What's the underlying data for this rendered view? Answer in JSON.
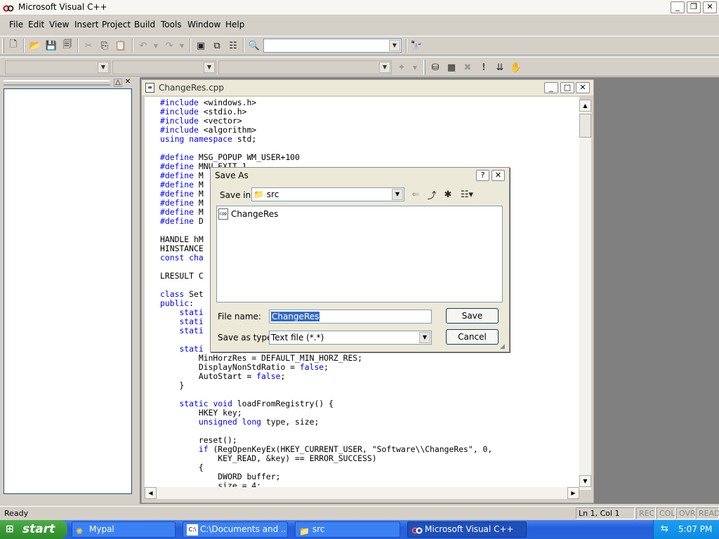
{
  "app": {
    "title": "Microsoft Visual C++"
  },
  "menu": [
    "File",
    "Edit",
    "View",
    "Insert",
    "Project",
    "Build",
    "Tools",
    "Window",
    "Help"
  ],
  "document": {
    "title": "ChangeRes.cpp",
    "code_lines": [
      [
        [
          "kw",
          "#include"
        ],
        [
          "",
          "<windows.h>"
        ]
      ],
      [
        [
          "kw",
          "#include"
        ],
        [
          "",
          "<stdio.h>"
        ]
      ],
      [
        [
          "kw",
          "#include"
        ],
        [
          "",
          "<vector>"
        ]
      ],
      [
        [
          "kw",
          "#include"
        ],
        [
          "",
          "<algorithm>"
        ]
      ],
      [
        [
          "kw",
          "using"
        ],
        [
          "",
          ""
        ],
        [
          "kw",
          "namespace"
        ],
        [
          "",
          "std;"
        ]
      ],
      [
        [
          "",
          ""
        ]
      ],
      [
        [
          "kw",
          "#define"
        ],
        [
          "",
          "MSG_POPUP WM_USER+100"
        ]
      ],
      [
        [
          "kw",
          "#define"
        ],
        [
          "",
          "MNU_EXIT 1"
        ]
      ],
      [
        [
          "kw",
          "#define"
        ],
        [
          "",
          "M"
        ]
      ],
      [
        [
          "kw",
          "#define"
        ],
        [
          "",
          "M"
        ]
      ],
      [
        [
          "kw",
          "#define"
        ],
        [
          "",
          "M"
        ]
      ],
      [
        [
          "kw",
          "#define"
        ],
        [
          "",
          "M"
        ]
      ],
      [
        [
          "kw",
          "#define"
        ],
        [
          "",
          "M"
        ]
      ],
      [
        [
          "kw",
          "#define"
        ],
        [
          "",
          "D"
        ]
      ],
      [
        [
          "",
          ""
        ]
      ],
      [
        [
          "",
          "HANDLE hM"
        ]
      ],
      [
        [
          "",
          "HINSTANCE"
        ]
      ],
      [
        [
          "kw",
          "const"
        ],
        [
          "",
          ""
        ],
        [
          "kw",
          "cha"
        ]
      ],
      [
        [
          "",
          ""
        ]
      ],
      [
        [
          "",
          "LRESULT C"
        ]
      ],
      [
        [
          "",
          ""
        ]
      ],
      [
        [
          "kw",
          "class"
        ],
        [
          "",
          "Set"
        ]
      ],
      [
        [
          "kw",
          "public"
        ],
        [
          ":"
        ]
      ],
      [
        [
          "",
          "    "
        ],
        [
          "kw",
          "stati"
        ]
      ],
      [
        [
          "",
          "    "
        ],
        [
          "kw",
          "stati"
        ]
      ],
      [
        [
          "",
          "    "
        ],
        [
          "kw",
          "stati"
        ]
      ],
      [
        [
          "",
          ""
        ]
      ],
      [
        [
          "",
          "    "
        ],
        [
          "kw",
          "stati"
        ]
      ],
      [
        [
          "",
          "        MinHorzRes = DEFAULT_MIN_HORZ_RES;"
        ]
      ],
      [
        [
          "",
          "        DisplayNonStdRatio = "
        ],
        [
          "kw",
          "false"
        ],
        [
          "",
          ";"
        ]
      ],
      [
        [
          "",
          "        AutoStart = "
        ],
        [
          "kw",
          "false"
        ],
        [
          "",
          ";"
        ]
      ],
      [
        [
          "",
          "    }"
        ]
      ],
      [
        [
          "",
          ""
        ]
      ],
      [
        [
          "",
          "    "
        ],
        [
          "kw",
          "static"
        ],
        [
          "",
          ""
        ],
        [
          "kw",
          "void"
        ],
        [
          "",
          "loadFromRegistry() {"
        ]
      ],
      [
        [
          "",
          "        HKEY key;"
        ]
      ],
      [
        [
          "",
          "        "
        ],
        [
          "kw",
          "unsigned"
        ],
        [
          "",
          ""
        ],
        [
          "kw",
          "long"
        ],
        [
          "",
          "type, size;"
        ]
      ],
      [
        [
          "",
          ""
        ]
      ],
      [
        [
          "",
          "        reset();"
        ]
      ],
      [
        [
          "",
          "        "
        ],
        [
          "kw",
          "if"
        ],
        [
          "",
          "(RegOpenKeyEx(HKEY_CURRENT_USER, \"Software\\\\ChangeRes\", 0,"
        ]
      ],
      [
        [
          "",
          "            KEY_READ, &key) == ERROR_SUCCESS)"
        ]
      ],
      [
        [
          "",
          "        {"
        ]
      ],
      [
        [
          "",
          "            DWORD buffer;"
        ]
      ],
      [
        [
          "",
          "            size = 4;"
        ]
      ]
    ]
  },
  "dialog": {
    "title": "Save As",
    "save_in_label": "Save in:",
    "save_in_value": "src",
    "file_item": "ChangeRes",
    "file_name_label": "File name:",
    "file_name_value": "ChangeRes",
    "save_type_label": "Save as type:",
    "save_type_value": "Text file (*.*)",
    "save_button": "Save",
    "cancel_button": "Cancel",
    "help_glyph": "?",
    "close_glyph": "✕"
  },
  "status": {
    "text": "Ready",
    "position": "Ln 1, Col 1",
    "indicators": [
      "REC",
      "COL",
      "OVR",
      "READ"
    ]
  },
  "taskbar": {
    "start": "start",
    "tasks": [
      "Mypal",
      "C:\\Documents and ...",
      "src",
      "Microsoft Visual C++"
    ],
    "clock": "5:07 PM"
  }
}
